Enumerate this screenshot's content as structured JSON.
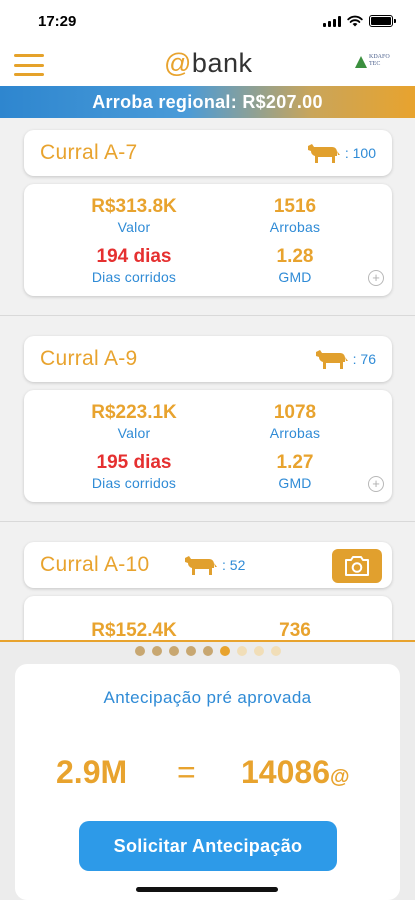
{
  "status_bar": {
    "time": "17:29"
  },
  "header": {
    "logo_at": "@",
    "logo_text": "bank",
    "partner_logo_text": "KDAFO TEC"
  },
  "banner": {
    "text": "Arroba regional: R$207.00"
  },
  "currais": [
    {
      "title": "Curral A-7",
      "cow_count": ": 100",
      "valor": "R$313.8K",
      "valor_label": "Valor",
      "arrobas": "1516",
      "arrobas_label": "Arrobas",
      "dias": "194 dias",
      "dias_label": "Dias corridos",
      "gmd": "1.28",
      "gmd_label": "GMD",
      "plus": "+"
    },
    {
      "title": "Curral A-9",
      "cow_count": ": 76",
      "valor": "R$223.1K",
      "valor_label": "Valor",
      "arrobas": "1078",
      "arrobas_label": "Arrobas",
      "dias": "195 dias",
      "dias_label": "Dias corridos",
      "gmd": "1.27",
      "gmd_label": "GMD",
      "plus": "+"
    },
    {
      "title": "Curral A-10",
      "cow_count": ": 52",
      "valor": "R$152.4K",
      "arrobas": "736"
    }
  ],
  "pager": {
    "count": 10,
    "active_index": 5
  },
  "antecipacao": {
    "title": "Antecipação pré aprovada",
    "amount": "2.9M",
    "equals": "=",
    "arrobas": "14086",
    "arrobas_unit": "@",
    "button_label": "Solicitar Antecipação"
  },
  "colors": {
    "accent_gold": "#e8a32e",
    "accent_blue": "#2f8bd6",
    "alert_red": "#e53030",
    "button_blue": "#2d9ae8"
  },
  "icons": [
    "menu-icon",
    "cow-icon",
    "camera-icon",
    "plus-circle-icon",
    "wifi-icon",
    "battery-icon",
    "signal-icon"
  ]
}
